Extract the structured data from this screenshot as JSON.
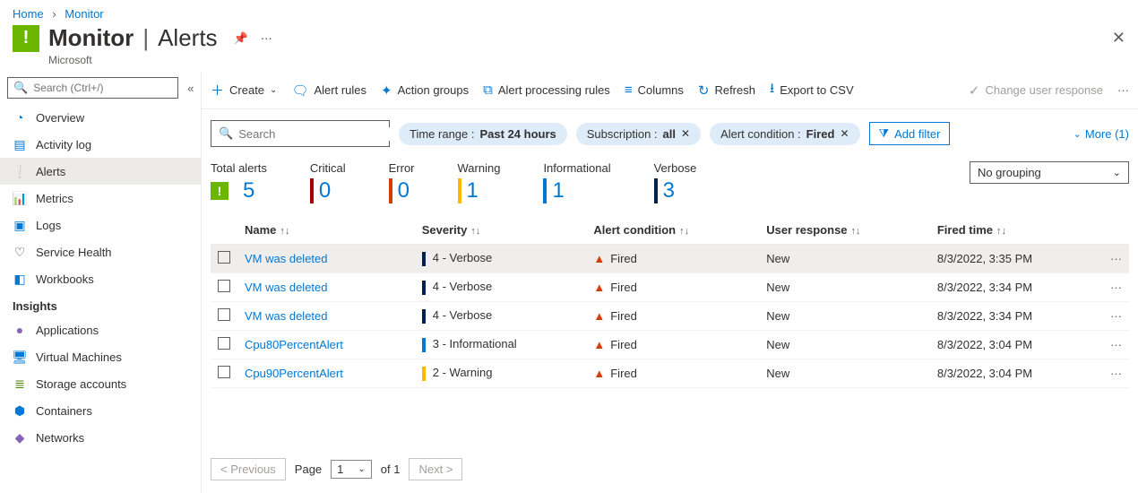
{
  "breadcrumb": {
    "home": "Home",
    "current": "Monitor"
  },
  "header": {
    "title": "Monitor",
    "section": "Alerts",
    "org": "Microsoft"
  },
  "sidebar": {
    "search_placeholder": "Search (Ctrl+/)",
    "items": [
      {
        "label": "Overview",
        "icon": "◔",
        "color": "#0078d4"
      },
      {
        "label": "Activity log",
        "icon": "▤",
        "color": "#0078d4"
      },
      {
        "label": "Alerts",
        "icon": "❕",
        "color": "#6bb700",
        "selected": true
      },
      {
        "label": "Metrics",
        "icon": "📊",
        "color": "#0078d4"
      },
      {
        "label": "Logs",
        "icon": "▣",
        "color": "#0078d4"
      },
      {
        "label": "Service Health",
        "icon": "♡",
        "color": "#323130"
      },
      {
        "label": "Workbooks",
        "icon": "◧",
        "color": "#0078d4"
      }
    ],
    "section_label": "Insights",
    "insight_items": [
      {
        "label": "Applications",
        "icon": "●",
        "color": "#8764b8"
      },
      {
        "label": "Virtual Machines",
        "icon": "🖥",
        "color": "#0078d4"
      },
      {
        "label": "Storage accounts",
        "icon": "≣",
        "color": "#498205"
      },
      {
        "label": "Containers",
        "icon": "⬢",
        "color": "#0078d4"
      },
      {
        "label": "Networks",
        "icon": "◆",
        "color": "#8764b8"
      }
    ]
  },
  "toolbar": {
    "create": "Create",
    "alert_rules": "Alert rules",
    "action_groups": "Action groups",
    "processing_rules": "Alert processing rules",
    "columns": "Columns",
    "refresh": "Refresh",
    "export": "Export to CSV",
    "change_resp": "Change user response"
  },
  "filters": {
    "search_placeholder": "Search",
    "time_prefix": "Time range : ",
    "time_value": "Past 24 hours",
    "sub_prefix": "Subscription : ",
    "sub_value": "all",
    "cond_prefix": "Alert condition : ",
    "cond_value": "Fired",
    "add": "Add filter",
    "more": "More (1)"
  },
  "stats": {
    "total_label": "Total alerts",
    "total_value": "5",
    "crit_label": "Critical",
    "crit_value": "0",
    "err_label": "Error",
    "err_value": "0",
    "warn_label": "Warning",
    "warn_value": "1",
    "info_label": "Informational",
    "info_value": "1",
    "verb_label": "Verbose",
    "verb_value": "3",
    "grouping": "No grouping"
  },
  "columns": {
    "name": "Name",
    "severity": "Severity",
    "condition": "Alert condition",
    "response": "User response",
    "fired": "Fired time"
  },
  "rows": [
    {
      "name": "VM was deleted",
      "severity": "4 - Verbose",
      "sev_color": "#002050",
      "condition": "Fired",
      "response": "New",
      "fired": "8/3/2022, 3:35 PM",
      "hovered": true
    },
    {
      "name": "VM was deleted",
      "severity": "4 - Verbose",
      "sev_color": "#002050",
      "condition": "Fired",
      "response": "New",
      "fired": "8/3/2022, 3:34 PM"
    },
    {
      "name": "VM was deleted",
      "severity": "4 - Verbose",
      "sev_color": "#002050",
      "condition": "Fired",
      "response": "New",
      "fired": "8/3/2022, 3:34 PM"
    },
    {
      "name": "Cpu80PercentAlert",
      "severity": "3 - Informational",
      "sev_color": "#0078d4",
      "condition": "Fired",
      "response": "New",
      "fired": "8/3/2022, 3:04 PM"
    },
    {
      "name": "Cpu90PercentAlert",
      "severity": "2 - Warning",
      "sev_color": "#ffb900",
      "condition": "Fired",
      "response": "New",
      "fired": "8/3/2022, 3:04 PM"
    }
  ],
  "pager": {
    "prev": "< Previous",
    "page_label_pre": "Page",
    "page": "1",
    "page_label_post": "of 1",
    "next": "Next >"
  }
}
